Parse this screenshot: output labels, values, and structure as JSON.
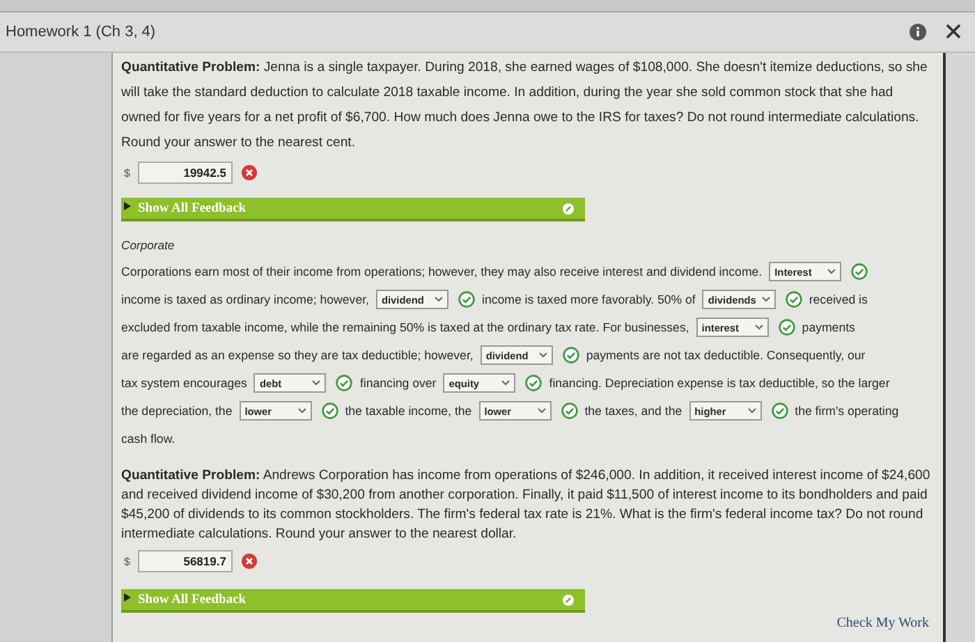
{
  "header": {
    "title": "Homework 1 (Ch 3, 4)"
  },
  "problem_1": {
    "question": "**Quantitative Problem:** Jenna is a single taxpayer. During 2018, she earned wages of $108,000. She doesn't itemize deductions, so she will take the standard deduction to calculate 2018 taxable income. In addition, during the year she sold common stock that she had owned for five years for a net profit of $6,700. How much does Jenna owe to the IRS for taxes? Do not round intermediate calculations. Round your answer to the nearest cent.",
    "currency": "$",
    "answer": "19942.5",
    "correct": false,
    "feedback": "Show All Feedback"
  },
  "corporate": {
    "heading": "Corporate",
    "lines": [
      [
        {
          "kind": "text",
          "text": "Corporations earn most of their income from operations; however, they may also receive interest and dividend income."
        },
        {
          "kind": "choice",
          "value": "Interest",
          "correct": true
        }
      ],
      [
        {
          "kind": "text",
          "text": "income is taxed as ordinary income; however,"
        },
        {
          "kind": "choice",
          "value": "dividend",
          "correct": true
        },
        {
          "kind": "text",
          "text": "income is taxed more favorably. 50% of"
        },
        {
          "kind": "choice",
          "value": "dividends",
          "correct": true
        },
        {
          "kind": "text",
          "text": "received is"
        }
      ],
      [
        {
          "kind": "text",
          "text": "excluded from taxable income, while the remaining 50% is taxed at the ordinary tax rate. For businesses,"
        },
        {
          "kind": "choice",
          "value": "interest",
          "correct": true
        },
        {
          "kind": "text",
          "text": "payments"
        }
      ],
      [
        {
          "kind": "text",
          "text": "are regarded as an expense so they are tax deductible; however,"
        },
        {
          "kind": "choice",
          "value": "dividend",
          "correct": true
        },
        {
          "kind": "text",
          "text": "payments are not tax deductible. Consequently, our"
        }
      ],
      [
        {
          "kind": "text",
          "text": "tax system encourages"
        },
        {
          "kind": "choice",
          "value": "debt",
          "correct": true
        },
        {
          "kind": "text",
          "text": "financing over"
        },
        {
          "kind": "choice",
          "value": "equity",
          "correct": true
        },
        {
          "kind": "text",
          "text": "financing. Depreciation expense is tax deductible, so the larger"
        }
      ],
      [
        {
          "kind": "text",
          "text": "the depreciation, the"
        },
        {
          "kind": "choice",
          "value": "lower",
          "correct": true
        },
        {
          "kind": "text",
          "text": "the taxable income, the"
        },
        {
          "kind": "choice",
          "value": "lower",
          "correct": true
        },
        {
          "kind": "text",
          "text": "the taxes, and the"
        },
        {
          "kind": "choice",
          "value": "higher",
          "correct": true
        },
        {
          "kind": "text",
          "text": "the firm's operating"
        }
      ],
      [
        {
          "kind": "text",
          "text": "cash flow."
        }
      ]
    ]
  },
  "problem_2": {
    "question": "**Quantitative Problem:** Andrews Corporation has income from operations of $246,000. In addition, it received interest income of $24,600 and received dividend income of $30,200 from another corporation. Finally, it paid $11,500 of interest income to its bondholders and paid $45,200 of dividends to its common stockholders. The firm's federal tax rate is 21%. What is the firm's federal income tax? Do not round intermediate calculations. Round your answer to the nearest dollar.",
    "currency": "$",
    "answer": "56819.7",
    "correct": false,
    "feedback": "Show All Feedback"
  },
  "check_button": "Check My Work"
}
